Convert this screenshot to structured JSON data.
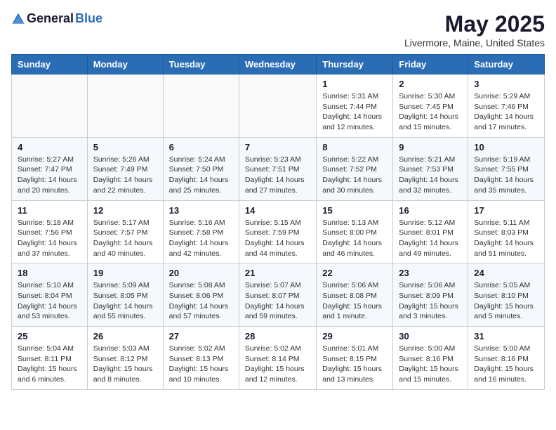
{
  "header": {
    "logo_general": "General",
    "logo_blue": "Blue",
    "title": "May 2025",
    "subtitle": "Livermore, Maine, United States"
  },
  "calendar": {
    "days_of_week": [
      "Sunday",
      "Monday",
      "Tuesday",
      "Wednesday",
      "Thursday",
      "Friday",
      "Saturday"
    ],
    "weeks": [
      [
        {
          "day": "",
          "info": ""
        },
        {
          "day": "",
          "info": ""
        },
        {
          "day": "",
          "info": ""
        },
        {
          "day": "",
          "info": ""
        },
        {
          "day": "1",
          "info": "Sunrise: 5:31 AM\nSunset: 7:44 PM\nDaylight: 14 hours\nand 12 minutes."
        },
        {
          "day": "2",
          "info": "Sunrise: 5:30 AM\nSunset: 7:45 PM\nDaylight: 14 hours\nand 15 minutes."
        },
        {
          "day": "3",
          "info": "Sunrise: 5:29 AM\nSunset: 7:46 PM\nDaylight: 14 hours\nand 17 minutes."
        }
      ],
      [
        {
          "day": "4",
          "info": "Sunrise: 5:27 AM\nSunset: 7:47 PM\nDaylight: 14 hours\nand 20 minutes."
        },
        {
          "day": "5",
          "info": "Sunrise: 5:26 AM\nSunset: 7:49 PM\nDaylight: 14 hours\nand 22 minutes."
        },
        {
          "day": "6",
          "info": "Sunrise: 5:24 AM\nSunset: 7:50 PM\nDaylight: 14 hours\nand 25 minutes."
        },
        {
          "day": "7",
          "info": "Sunrise: 5:23 AM\nSunset: 7:51 PM\nDaylight: 14 hours\nand 27 minutes."
        },
        {
          "day": "8",
          "info": "Sunrise: 5:22 AM\nSunset: 7:52 PM\nDaylight: 14 hours\nand 30 minutes."
        },
        {
          "day": "9",
          "info": "Sunrise: 5:21 AM\nSunset: 7:53 PM\nDaylight: 14 hours\nand 32 minutes."
        },
        {
          "day": "10",
          "info": "Sunrise: 5:19 AM\nSunset: 7:55 PM\nDaylight: 14 hours\nand 35 minutes."
        }
      ],
      [
        {
          "day": "11",
          "info": "Sunrise: 5:18 AM\nSunset: 7:56 PM\nDaylight: 14 hours\nand 37 minutes."
        },
        {
          "day": "12",
          "info": "Sunrise: 5:17 AM\nSunset: 7:57 PM\nDaylight: 14 hours\nand 40 minutes."
        },
        {
          "day": "13",
          "info": "Sunrise: 5:16 AM\nSunset: 7:58 PM\nDaylight: 14 hours\nand 42 minutes."
        },
        {
          "day": "14",
          "info": "Sunrise: 5:15 AM\nSunset: 7:59 PM\nDaylight: 14 hours\nand 44 minutes."
        },
        {
          "day": "15",
          "info": "Sunrise: 5:13 AM\nSunset: 8:00 PM\nDaylight: 14 hours\nand 46 minutes."
        },
        {
          "day": "16",
          "info": "Sunrise: 5:12 AM\nSunset: 8:01 PM\nDaylight: 14 hours\nand 49 minutes."
        },
        {
          "day": "17",
          "info": "Sunrise: 5:11 AM\nSunset: 8:03 PM\nDaylight: 14 hours\nand 51 minutes."
        }
      ],
      [
        {
          "day": "18",
          "info": "Sunrise: 5:10 AM\nSunset: 8:04 PM\nDaylight: 14 hours\nand 53 minutes."
        },
        {
          "day": "19",
          "info": "Sunrise: 5:09 AM\nSunset: 8:05 PM\nDaylight: 14 hours\nand 55 minutes."
        },
        {
          "day": "20",
          "info": "Sunrise: 5:08 AM\nSunset: 8:06 PM\nDaylight: 14 hours\nand 57 minutes."
        },
        {
          "day": "21",
          "info": "Sunrise: 5:07 AM\nSunset: 8:07 PM\nDaylight: 14 hours\nand 59 minutes."
        },
        {
          "day": "22",
          "info": "Sunrise: 5:06 AM\nSunset: 8:08 PM\nDaylight: 15 hours\nand 1 minute."
        },
        {
          "day": "23",
          "info": "Sunrise: 5:06 AM\nSunset: 8:09 PM\nDaylight: 15 hours\nand 3 minutes."
        },
        {
          "day": "24",
          "info": "Sunrise: 5:05 AM\nSunset: 8:10 PM\nDaylight: 15 hours\nand 5 minutes."
        }
      ],
      [
        {
          "day": "25",
          "info": "Sunrise: 5:04 AM\nSunset: 8:11 PM\nDaylight: 15 hours\nand 6 minutes."
        },
        {
          "day": "26",
          "info": "Sunrise: 5:03 AM\nSunset: 8:12 PM\nDaylight: 15 hours\nand 8 minutes."
        },
        {
          "day": "27",
          "info": "Sunrise: 5:02 AM\nSunset: 8:13 PM\nDaylight: 15 hours\nand 10 minutes."
        },
        {
          "day": "28",
          "info": "Sunrise: 5:02 AM\nSunset: 8:14 PM\nDaylight: 15 hours\nand 12 minutes."
        },
        {
          "day": "29",
          "info": "Sunrise: 5:01 AM\nSunset: 8:15 PM\nDaylight: 15 hours\nand 13 minutes."
        },
        {
          "day": "30",
          "info": "Sunrise: 5:00 AM\nSunset: 8:16 PM\nDaylight: 15 hours\nand 15 minutes."
        },
        {
          "day": "31",
          "info": "Sunrise: 5:00 AM\nSunset: 8:16 PM\nDaylight: 15 hours\nand 16 minutes."
        }
      ]
    ]
  }
}
